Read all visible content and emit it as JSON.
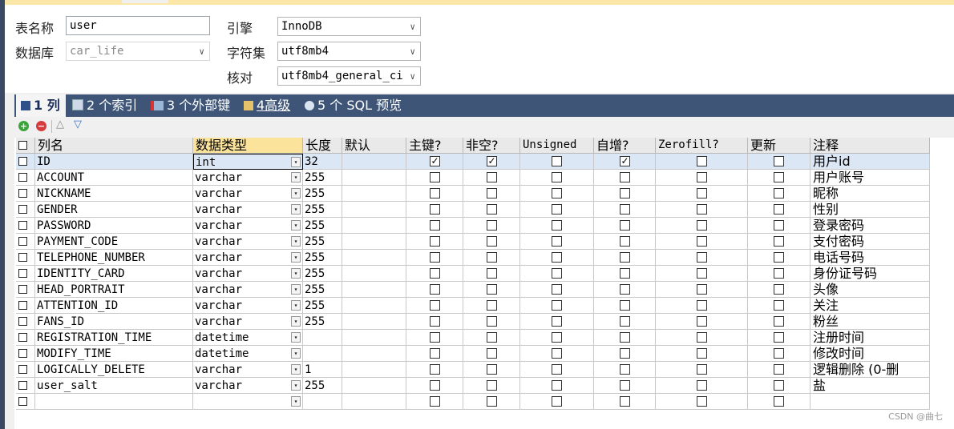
{
  "form": {
    "table_name_label": "表名称",
    "table_name_value": "user",
    "database_label": "数据库",
    "database_value": "car_life",
    "engine_label": "引擎",
    "engine_value": "InnoDB",
    "charset_label": "字符集",
    "charset_value": "utf8mb4",
    "collation_label": "核对",
    "collation_value": "utf8mb4_general_ci"
  },
  "tabs": [
    {
      "label": "1 列",
      "icon": "columns-icon",
      "active": true
    },
    {
      "label": "2 个索引",
      "icon": "index-icon",
      "active": false
    },
    {
      "label": "3 个外部键",
      "icon": "foreign-key-icon",
      "active": false
    },
    {
      "label": "4高级",
      "icon": "advanced-icon",
      "active": false
    },
    {
      "label": "5 个 SQL 预览",
      "icon": "sql-preview-icon",
      "active": false
    }
  ],
  "toolbar": {
    "add_icon": "plus-icon",
    "remove_icon": "minus-icon",
    "up_icon": "arrow-up-icon",
    "down_icon": "arrow-down-icon"
  },
  "headers": {
    "name": "列名",
    "type": "数据类型",
    "length": "长度",
    "default": "默认",
    "pk": "主键?",
    "not_null": "非空?",
    "unsigned": "Unsigned",
    "auto_increment": "自增?",
    "zerofill": "Zerofill?",
    "on_update": "更新",
    "comment": "注释"
  },
  "rows": [
    {
      "name": "ID",
      "type": "int",
      "length": "32",
      "pk": true,
      "nn": true,
      "ai": true,
      "comment": "用户id"
    },
    {
      "name": "ACCOUNT",
      "type": "varchar",
      "length": "255",
      "pk": false,
      "nn": false,
      "ai": false,
      "comment": "用户账号"
    },
    {
      "name": "NICKNAME",
      "type": "varchar",
      "length": "255",
      "pk": false,
      "nn": false,
      "ai": false,
      "comment": "昵称"
    },
    {
      "name": "GENDER",
      "type": "varchar",
      "length": "255",
      "pk": false,
      "nn": false,
      "ai": false,
      "comment": "性别"
    },
    {
      "name": "PASSWORD",
      "type": "varchar",
      "length": "255",
      "pk": false,
      "nn": false,
      "ai": false,
      "comment": "登录密码"
    },
    {
      "name": "PAYMENT_CODE",
      "type": "varchar",
      "length": "255",
      "pk": false,
      "nn": false,
      "ai": false,
      "comment": "支付密码"
    },
    {
      "name": "TELEPHONE_NUMBER",
      "type": "varchar",
      "length": "255",
      "pk": false,
      "nn": false,
      "ai": false,
      "comment": "电话号码"
    },
    {
      "name": "IDENTITY_CARD",
      "type": "varchar",
      "length": "255",
      "pk": false,
      "nn": false,
      "ai": false,
      "comment": "身份证号码"
    },
    {
      "name": "HEAD_PORTRAIT",
      "type": "varchar",
      "length": "255",
      "pk": false,
      "nn": false,
      "ai": false,
      "comment": "头像"
    },
    {
      "name": "ATTENTION_ID",
      "type": "varchar",
      "length": "255",
      "pk": false,
      "nn": false,
      "ai": false,
      "comment": "关注"
    },
    {
      "name": "FANS_ID",
      "type": "varchar",
      "length": "255",
      "pk": false,
      "nn": false,
      "ai": false,
      "comment": "粉丝"
    },
    {
      "name": "REGISTRATION_TIME",
      "type": "datetime",
      "length": "",
      "pk": false,
      "nn": false,
      "ai": false,
      "comment": "注册时间"
    },
    {
      "name": "MODIFY_TIME",
      "type": "datetime",
      "length": "",
      "pk": false,
      "nn": false,
      "ai": false,
      "comment": "修改时间"
    },
    {
      "name": "LOGICALLY_DELETE",
      "type": "varchar",
      "length": "1",
      "pk": false,
      "nn": false,
      "ai": false,
      "comment": "逻辑删除 (0-删"
    },
    {
      "name": "user_salt",
      "type": "varchar",
      "length": "255",
      "pk": false,
      "nn": false,
      "ai": false,
      "comment": "盐"
    },
    {
      "name": "",
      "type": "",
      "length": "",
      "pk": false,
      "nn": false,
      "ai": false,
      "comment": ""
    }
  ],
  "watermark": "CSDN @曲七",
  "colors": {
    "tab_bar": "#3e5578",
    "selected_row": "#dbe7f5",
    "sorted_header": "#fbe39b"
  }
}
